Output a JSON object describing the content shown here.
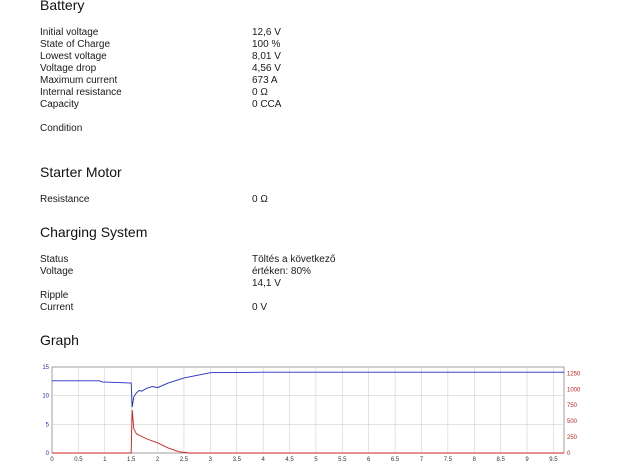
{
  "battery": {
    "title": "Battery",
    "rows": [
      {
        "label": "Initial voltage",
        "value": "12,6 V"
      },
      {
        "label": "State of Charge",
        "value": "100 %"
      },
      {
        "label": "Lowest voltage",
        "value": "8,01 V"
      },
      {
        "label": "Voltage drop",
        "value": "4,56 V"
      },
      {
        "label": "Maximum current",
        "value": "673 A"
      },
      {
        "label": "Internal resistance",
        "value": "0 Ω"
      },
      {
        "label": "Capacity",
        "value": "0 CCA"
      }
    ],
    "condition_label": "Condition"
  },
  "starter": {
    "title": "Starter Motor",
    "resistance_label": "Resistance",
    "resistance_value": "0 Ω"
  },
  "charging": {
    "title": "Charging System",
    "status_label": "Status",
    "status_value_line1": "Töltés a következő",
    "status_value_line2": "értéken: 80%",
    "voltage_label": "Voltage",
    "voltage_value": "14,1 V",
    "ripple_label": "Ripple",
    "current_label": "Current",
    "current_value": "0 V"
  },
  "graph": {
    "title": "Graph",
    "colors": {
      "voltage": "#1f2fbf",
      "current": "#d02020",
      "grid": "#c8c8c8",
      "frame": "#888888"
    },
    "chart_data": {
      "type": "line",
      "x_ticks": [
        "0",
        "0.5",
        "1",
        "1.5",
        "2",
        "2.5",
        "3",
        "3.5",
        "4",
        "4.5",
        "5",
        "5.5",
        "6",
        "6.5",
        "7",
        "7.5",
        "8",
        "8.5",
        "9",
        "9.5"
      ],
      "xlim": [
        0,
        9.7
      ],
      "y_left_ticks": [
        "15",
        "10",
        "5",
        "0"
      ],
      "ylim_left": [
        0,
        15
      ],
      "y_right_ticks": [
        "1250",
        "1000",
        "750",
        "500",
        "250",
        "0"
      ],
      "ylim_right": [
        0,
        1350
      ],
      "series": [
        {
          "axis": "left",
          "x": [
            0,
            0.9,
            0.95,
            1.5,
            1.52,
            1.55,
            1.6,
            1.65,
            1.7,
            1.8,
            1.9,
            2.0,
            2.2,
            2.5,
            3,
            4,
            5,
            6,
            7,
            8,
            9,
            9.7
          ],
          "values": [
            12.6,
            12.6,
            12.4,
            12.2,
            8.01,
            9.8,
            10.5,
            10.9,
            10.8,
            11.3,
            11.6,
            11.4,
            12.2,
            13.1,
            14.0,
            14.1,
            14.1,
            14.1,
            14.1,
            14.1,
            14.1,
            14.1
          ]
        },
        {
          "axis": "right",
          "x": [
            0,
            1.0,
            1.4,
            1.5,
            1.52,
            1.55,
            1.6,
            1.8,
            2.0,
            2.2,
            2.4,
            2.6,
            3,
            4,
            5,
            6,
            7,
            8,
            9,
            9.7
          ],
          "values": [
            0,
            0,
            0,
            0,
            673,
            380,
            300,
            220,
            160,
            80,
            20,
            0,
            0,
            0,
            0,
            0,
            0,
            0,
            0,
            0
          ]
        }
      ]
    }
  }
}
